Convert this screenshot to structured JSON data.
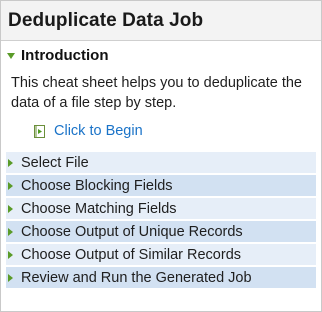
{
  "title": "Deduplicate Data Job",
  "intro": {
    "label": "Introduction",
    "body": "This cheat sheet helps you to deduplicate the data of a file step by step.",
    "begin_link": "Click to Begin",
    "begin_icon": "play-page-icon"
  },
  "steps": [
    {
      "label": "Select File"
    },
    {
      "label": "Choose Blocking Fields"
    },
    {
      "label": "Choose Matching Fields"
    },
    {
      "label": "Choose Output of Unique Records"
    },
    {
      "label": "Choose Output of Similar Records"
    },
    {
      "label": "Review and Run the Generated Job"
    }
  ],
  "colors": {
    "accent_green": "#5a9b28",
    "link_blue": "#1a73c8",
    "step_light": "#e6eef8",
    "step_dark": "#d2e1f2"
  }
}
